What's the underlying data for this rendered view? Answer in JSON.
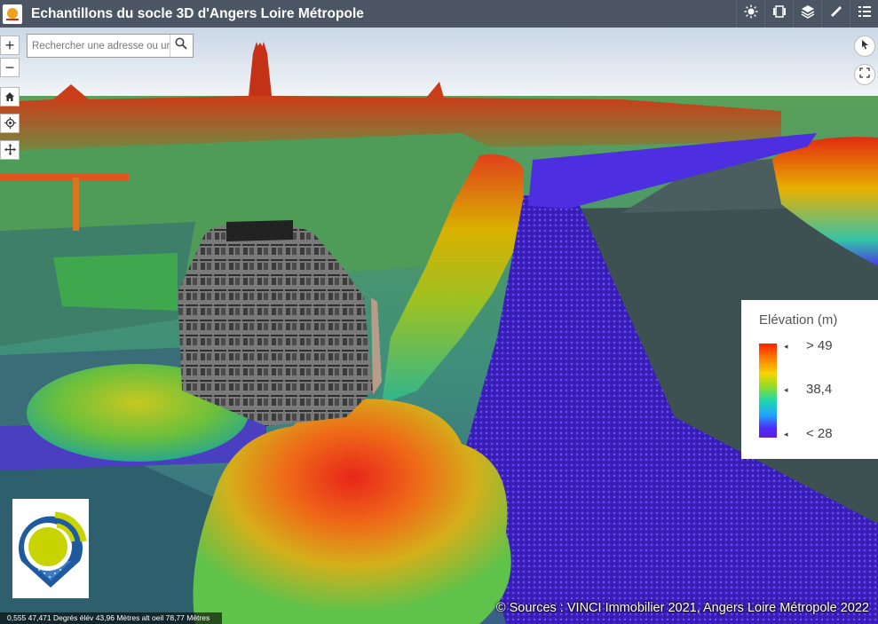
{
  "header": {
    "title": "Echantillons du socle 3D d'Angers Loire Métropole",
    "tools": [
      {
        "icon": "sun-icon",
        "name": "daylight"
      },
      {
        "icon": "slides-icon",
        "name": "slides"
      },
      {
        "icon": "layers-icon",
        "name": "layers"
      },
      {
        "icon": "measure-icon",
        "name": "measure"
      },
      {
        "icon": "list-icon",
        "name": "legend-list"
      }
    ]
  },
  "search": {
    "placeholder": "Rechercher une adresse ou un"
  },
  "controls": {
    "zoom_in": "+",
    "zoom_out": "−"
  },
  "legend": {
    "title": "Elévation (m)",
    "max_label": "> 49",
    "mid_label": "38,4",
    "min_label": "< 28",
    "tick": "◂",
    "colors": [
      "#ff1f00",
      "#ff7a00",
      "#f5d400",
      "#8fdc2a",
      "#21d9a6",
      "#1fa5ff",
      "#4d2cff"
    ]
  },
  "status": {
    "coordinates": "0,555 47,471 Degrés   élév 43,96 Mètres   alt oeil 78,77 Mètres"
  },
  "credits": {
    "text": "© Sources : VINCI Immobilier 2021, Angers Loire Métropole 2022"
  }
}
